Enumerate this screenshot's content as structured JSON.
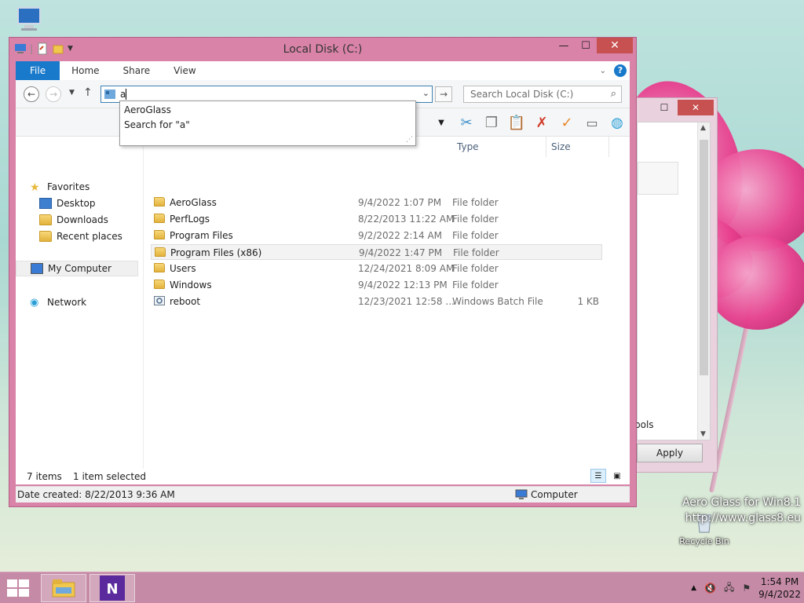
{
  "window": {
    "title": "Local Disk (C:)",
    "buttons": {
      "minimize": "—",
      "maximize": "☐",
      "close": "✕"
    }
  },
  "ribbon": {
    "tabs": [
      "File",
      "Home",
      "Share",
      "View"
    ],
    "help": "?"
  },
  "address": {
    "value": "a",
    "search_placeholder": "Search Local Disk (C:)"
  },
  "suggestions": [
    "AeroGlass",
    "Search for \"a\""
  ],
  "nav": {
    "favorites": "Favorites",
    "desktop": "Desktop",
    "downloads": "Downloads",
    "recent": "Recent places",
    "computer": "My Computer",
    "network": "Network"
  },
  "columns": {
    "type": "Type",
    "size": "Size"
  },
  "files": [
    {
      "name": "AeroGlass",
      "date": "9/4/2022 1:07 PM",
      "type": "File folder",
      "size": "",
      "icon": "folder-icon"
    },
    {
      "name": "PerfLogs",
      "date": "8/22/2013 11:22 AM",
      "type": "File folder",
      "size": "",
      "icon": "folder-icon"
    },
    {
      "name": "Program Files",
      "date": "9/2/2022 2:14 AM",
      "type": "File folder",
      "size": "",
      "icon": "folder-icon"
    },
    {
      "name": "Program Files (x86)",
      "date": "9/4/2022 1:47 PM",
      "type": "File folder",
      "size": "",
      "icon": "folder-icon"
    },
    {
      "name": "Users",
      "date": "12/24/2021 8:09 AM",
      "type": "File folder",
      "size": "",
      "icon": "folder-icon"
    },
    {
      "name": "Windows",
      "date": "9/4/2022 12:13 PM",
      "type": "File folder",
      "size": "",
      "icon": "folder-icon"
    },
    {
      "name": "reboot",
      "date": "12/23/2021 12:58 ...",
      "type": "Windows Batch File",
      "size": "1 KB",
      "icon": "batch-file-icon"
    }
  ],
  "status": {
    "items": "7 items",
    "selected": "1 item selected"
  },
  "details": {
    "date_created": "Date created: 8/22/2013 9:36 AM",
    "location": "Computer"
  },
  "back_window": {
    "apply": "Apply",
    "partial_text": "bols"
  },
  "desktop": {
    "recycle_bin": "Recycle Bin",
    "watermark_line1": "Aero Glass for Win8.1",
    "watermark_line2": "http://www.glass8.eu"
  },
  "tray": {
    "time": "1:54 PM",
    "date": "9/4/2022"
  },
  "colors": {
    "window_frame": "#d983a8",
    "file_tab": "#1979ca",
    "taskbar": "#c58aa6",
    "close_button": "#c75050"
  }
}
